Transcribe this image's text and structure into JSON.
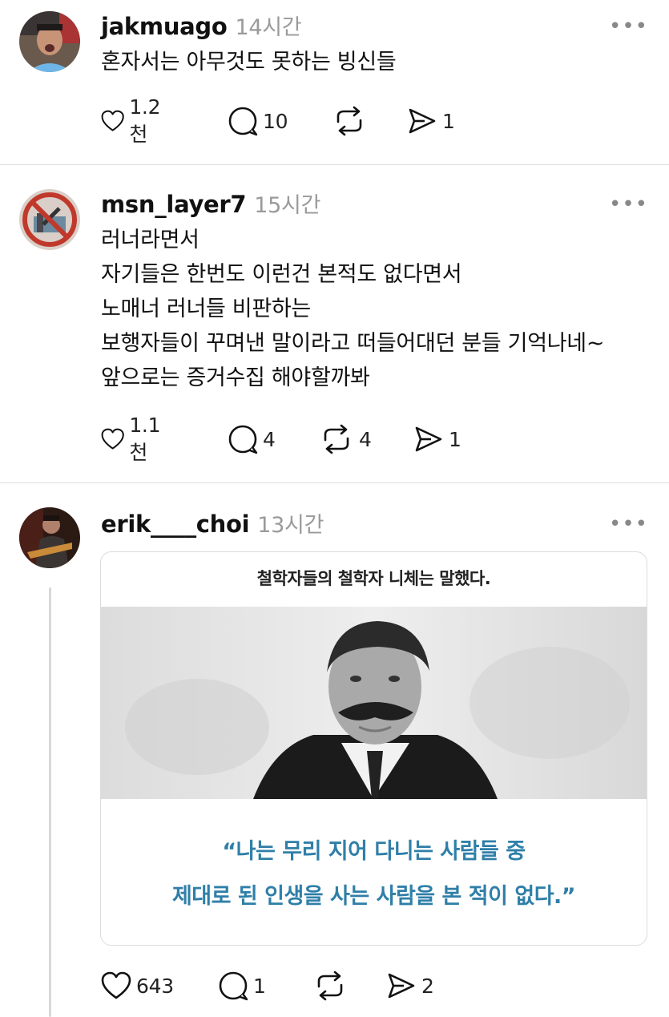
{
  "posts": [
    {
      "username": "jakmuago",
      "time": "14시간",
      "more": "•••",
      "lines": [
        "혼자서는 아무것도 못하는 빙신들"
      ],
      "stats": {
        "likes": "1.2천",
        "replies": "10",
        "reposts": "",
        "shares": "1"
      }
    },
    {
      "username": "msn_layer7",
      "time": "15시간",
      "more": "•••",
      "lines": [
        "러너라면서",
        "자기들은 한번도 이런건 본적도 없다면서",
        "노매너 러너들 비판하는",
        "보행자들이 꾸며낸 말이라고 떠들어대던 분들 기억나네~",
        "앞으로는 증거수집 해야할까봐"
      ],
      "stats": {
        "likes": "1.1천",
        "replies": "4",
        "reposts": "4",
        "shares": "1"
      }
    },
    {
      "username": "erik____choi",
      "time": "13시간",
      "more": "•••",
      "card": {
        "title": "철학자들의 철학자 니체는 말했다.",
        "quote_line1": "“나는 무리 지어 다니는 사람들 중",
        "quote_line2": "제대로 된 인생을 사는 사람을 본 적이 없다.”"
      },
      "stats": {
        "likes": "643",
        "replies": "1",
        "reposts": "",
        "shares": "2"
      }
    }
  ],
  "icons": [
    "heart-icon",
    "reply-icon",
    "repost-icon",
    "share-icon",
    "more-icon",
    "avatar"
  ],
  "colors": {
    "quote": "#2f7fa8",
    "timestamp": "#9a9a9a",
    "divider": "#dedede"
  }
}
